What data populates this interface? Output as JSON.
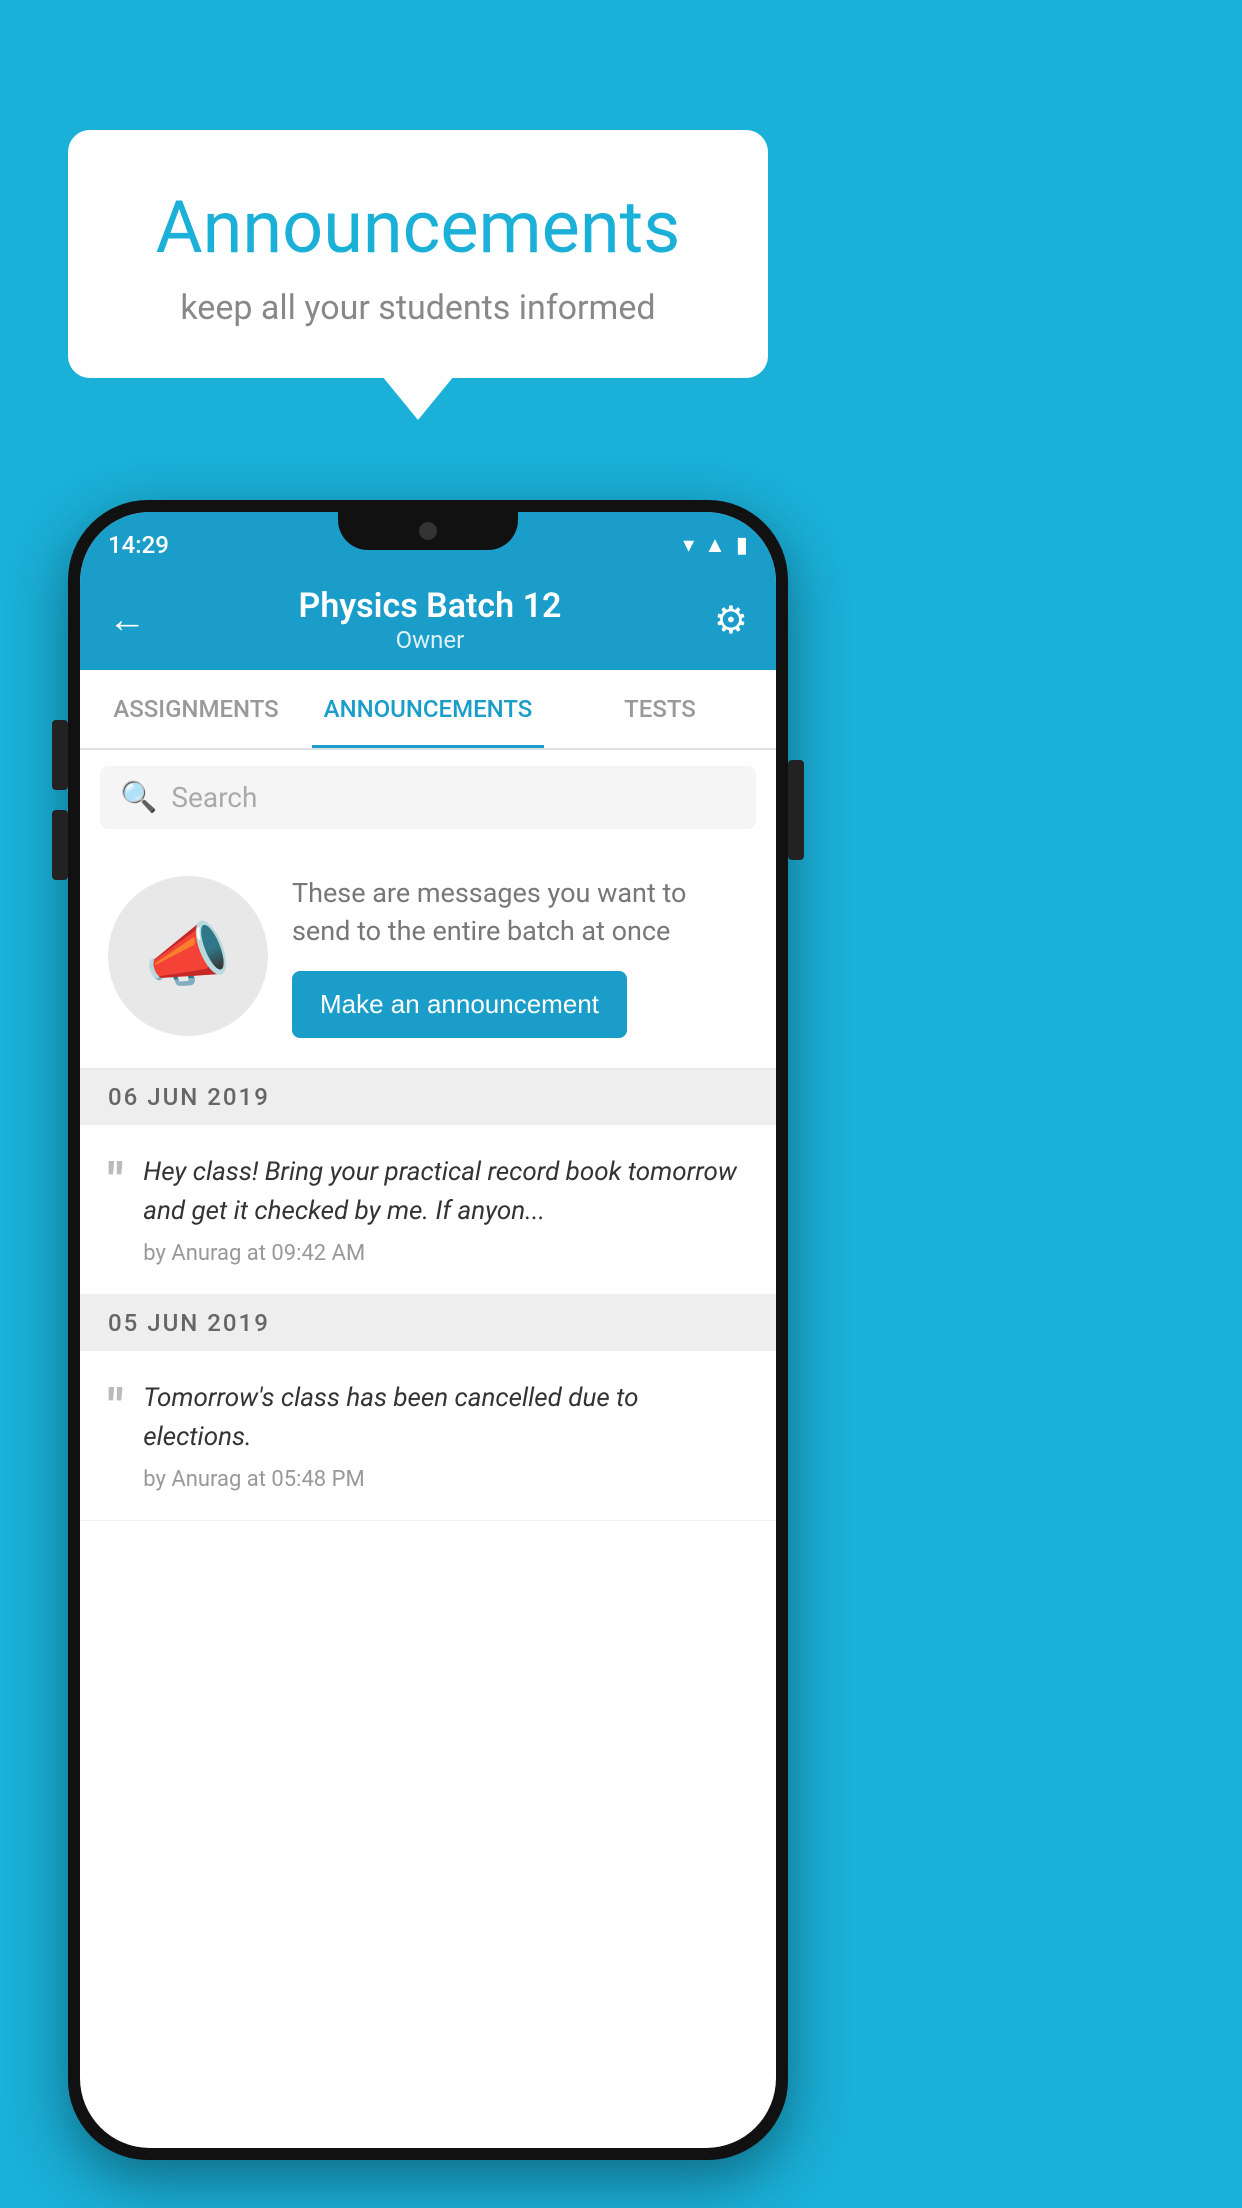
{
  "background_color": "#1ab0d8",
  "speech_bubble": {
    "title": "Announcements",
    "subtitle": "keep all your students informed"
  },
  "phone": {
    "status_bar": {
      "time": "14:29",
      "icons": [
        "wifi",
        "signal",
        "battery"
      ]
    },
    "app_bar": {
      "back_label": "←",
      "title": "Physics Batch 12",
      "subtitle": "Owner",
      "gear_label": "⚙"
    },
    "tabs": [
      {
        "label": "ASSIGNMENTS",
        "active": false
      },
      {
        "label": "ANNOUNCEMENTS",
        "active": true
      },
      {
        "label": "TESTS",
        "active": false
      }
    ],
    "search": {
      "placeholder": "Search"
    },
    "promo": {
      "description": "These are messages you want to send to the entire batch at once",
      "button_label": "Make an announcement"
    },
    "announcement_groups": [
      {
        "date": "06  JUN  2019",
        "items": [
          {
            "text": "Hey class! Bring your practical record book tomorrow and get it checked by me. If anyon...",
            "meta": "by Anurag at 09:42 AM"
          }
        ]
      },
      {
        "date": "05  JUN  2019",
        "items": [
          {
            "text": "Tomorrow's class has been cancelled due to elections.",
            "meta": "by Anurag at 05:48 PM"
          }
        ]
      }
    ]
  }
}
